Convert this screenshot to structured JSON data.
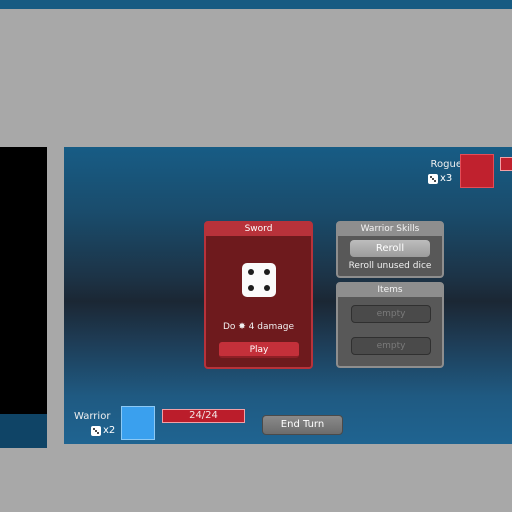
{
  "enemy": {
    "name": "Rogue",
    "dice_count": "x3"
  },
  "player": {
    "name": "Warrior",
    "dice_count": "x2",
    "hp": "24/24"
  },
  "end_turn_label": "End Turn",
  "sword_card": {
    "title": "Sword",
    "die_face": 4,
    "description": "Do ✸ 4 damage",
    "play_label": "Play"
  },
  "skills_card": {
    "title": "Warrior Skills",
    "reroll_label": "Reroll",
    "reroll_description": "Reroll unused dice"
  },
  "items_card": {
    "title": "Items",
    "slots": [
      "empty",
      "empty"
    ]
  },
  "colors": {
    "enemy": "#c0212e",
    "player": "#3aa0ee",
    "card_red": "#b8323a",
    "card_grey": "#8e8e8e"
  }
}
